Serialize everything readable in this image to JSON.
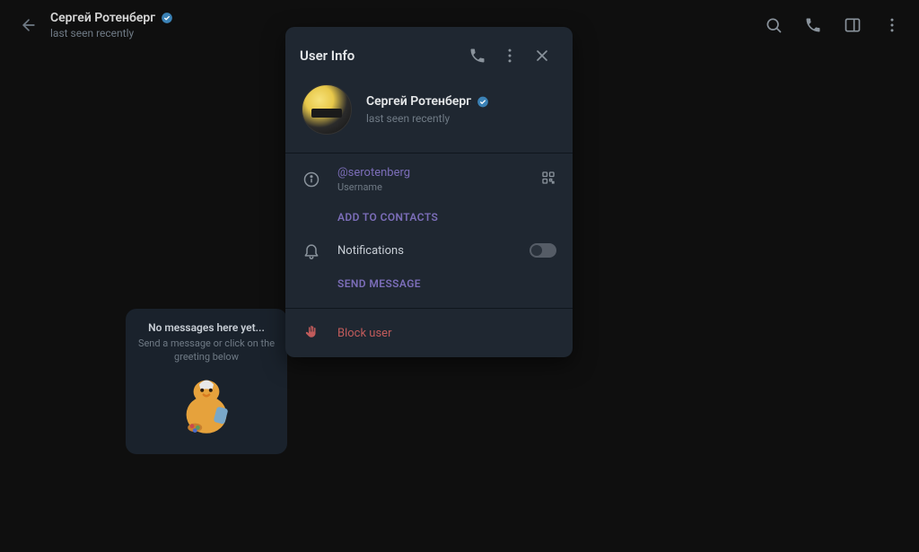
{
  "header": {
    "name": "Сергей Ротенберг",
    "status": "last seen recently"
  },
  "empty_state": {
    "title": "No messages here yet...",
    "subtitle": "Send a message or click on the greeting below"
  },
  "modal": {
    "title": "User Info",
    "profile": {
      "name": "Сергей Ротенберг",
      "status": "last seen recently"
    },
    "username": {
      "value": "@serotenberg",
      "label": "Username"
    },
    "add_to_contacts": "ADD TO CONTACTS",
    "notifications_label": "Notifications",
    "send_message": "SEND MESSAGE",
    "block_label": "Block user"
  }
}
